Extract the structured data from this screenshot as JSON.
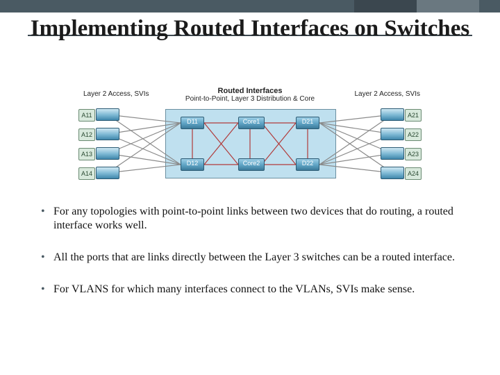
{
  "title": "Implementing Routed Interfaces on Switches",
  "diagram": {
    "leftLabel": "Layer 2 Access, SVIs",
    "rightLabel": "Layer 2 Access, SVIs",
    "midTitle": "Routed Interfaces",
    "midSub": "Point-to-Point, Layer 3 Distribution & Core",
    "leftAccess": [
      "A11",
      "A12",
      "A13",
      "A14"
    ],
    "rightAccess": [
      "A21",
      "A22",
      "A23",
      "A24"
    ],
    "dist": [
      "D11",
      "D12",
      "D21",
      "D22"
    ],
    "core": [
      "Core1",
      "Core2"
    ]
  },
  "bullets": [
    "For any topologies with point-to-point links between two devices that do routing, a routed interface works well.",
    "All the ports that are links directly between the Layer 3 switches can be a routed interface.",
    "For VLANS for which many interfaces connect to the VLANs, SVIs make sense."
  ]
}
